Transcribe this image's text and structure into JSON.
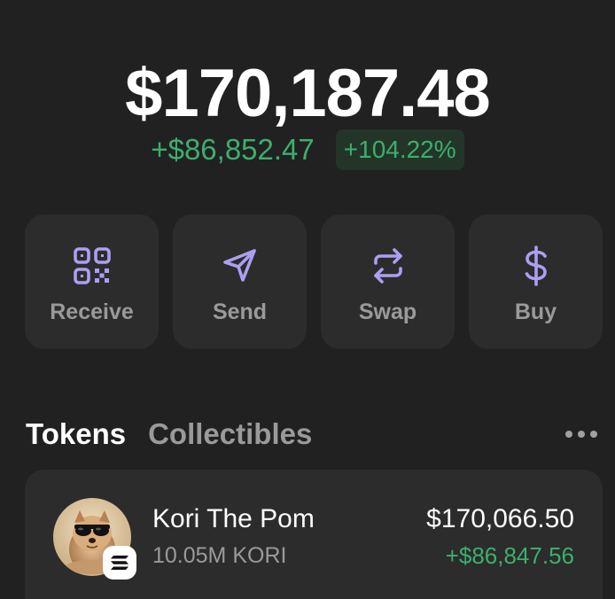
{
  "portfolio": {
    "balance": "$170,187.48",
    "change_amount": "+$86,852.47",
    "change_percent": "+104.22%"
  },
  "colors": {
    "positive": "#3dae6c",
    "accent": "#ab9ff2",
    "card": "#2c2c2c",
    "background": "#212121"
  },
  "actions": [
    {
      "label": "Receive",
      "icon": "qr-code-icon"
    },
    {
      "label": "Send",
      "icon": "send-icon"
    },
    {
      "label": "Swap",
      "icon": "swap-icon"
    },
    {
      "label": "Buy",
      "icon": "dollar-icon"
    }
  ],
  "tabs": {
    "tokens": "Tokens",
    "collectibles": "Collectibles",
    "more_icon": "more-horizontal-icon"
  },
  "tokens": [
    {
      "name": "Kori The Pom",
      "amount": "10.05M KORI",
      "value": "$170,066.50",
      "change": "+$86,847.56",
      "chain_icon": "solana-icon"
    }
  ]
}
